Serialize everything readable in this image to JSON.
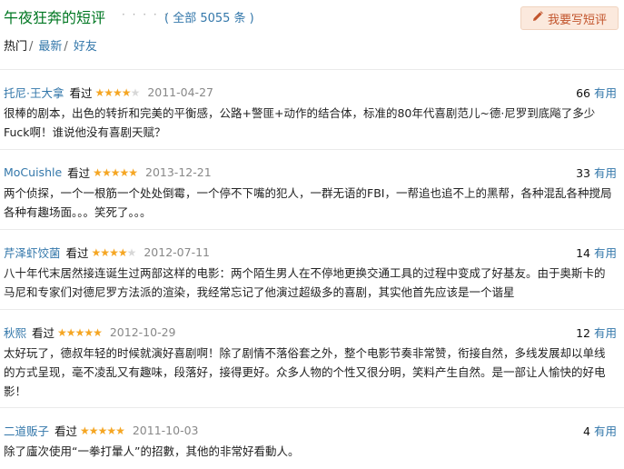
{
  "header": {
    "title": "午夜狂奔的短评",
    "dots": "· · · · · ·",
    "count": "( 全部 5055 条 )",
    "write_button": "我要写短评",
    "write_icon": "pencil-icon"
  },
  "filters": [
    {
      "label": "热门",
      "sep": "/"
    },
    {
      "label": "最新",
      "sep": "/"
    },
    {
      "label": "好友",
      "sep": ""
    }
  ],
  "reviews": [
    {
      "user": "托尼·王大拿",
      "status": "看过",
      "rating": 4,
      "date": "2011-04-27",
      "votes": "66",
      "votes_label": "有用",
      "content": "很棒的剧本，出色的转折和完美的平衡感，公路+警匪+动作的结合体，标准的80年代喜剧范儿~德·尼罗到底飚了多少Fuck啊！谁说他没有喜剧天赋？"
    },
    {
      "user": "MoCuishle",
      "status": "看过",
      "rating": 5,
      "date": "2013-12-21",
      "votes": "33",
      "votes_label": "有用",
      "content": "两个侦探，一个一根筋一个处处倒霉，一个停不下嘴的犯人，一群无语的FBI，一帮追也追不上的黑帮，各种混乱各种搅局各种有趣场面。。。笑死了。。。"
    },
    {
      "user": "芹泽虾饺菌",
      "status": "看过",
      "rating": 4,
      "date": "2012-07-11",
      "votes": "14",
      "votes_label": "有用",
      "content": "八十年代末居然接连诞生过两部这样的电影：两个陌生男人在不停地更换交通工具的过程中变成了好基友。由于奥斯卡的马尼和专家们对德尼罗方法派的渲染，我经常忘记了他演过超级多的喜剧，其实他首先应该是一个谐星"
    },
    {
      "user": "秋熙",
      "status": "看过",
      "rating": 5,
      "date": "2012-10-29",
      "votes": "12",
      "votes_label": "有用",
      "content": "太好玩了，德叔年轻的时候就演好喜剧啊！除了剧情不落俗套之外，整个电影节奏非常赞，衔接自然，多线发展却以单线的方式呈现，毫不凌乱又有趣味，段落好，接得更好。众多人物的个性又很分明，笑料产生自然。是一部让人愉快的好电影！"
    },
    {
      "user": "二道贩子",
      "status": "看过",
      "rating": 5,
      "date": "2011-10-03",
      "votes": "4",
      "votes_label": "有用",
      "content": "除了廬次使用“一拳打暈人”的招數，其他的非常好看動人。"
    }
  ]
}
